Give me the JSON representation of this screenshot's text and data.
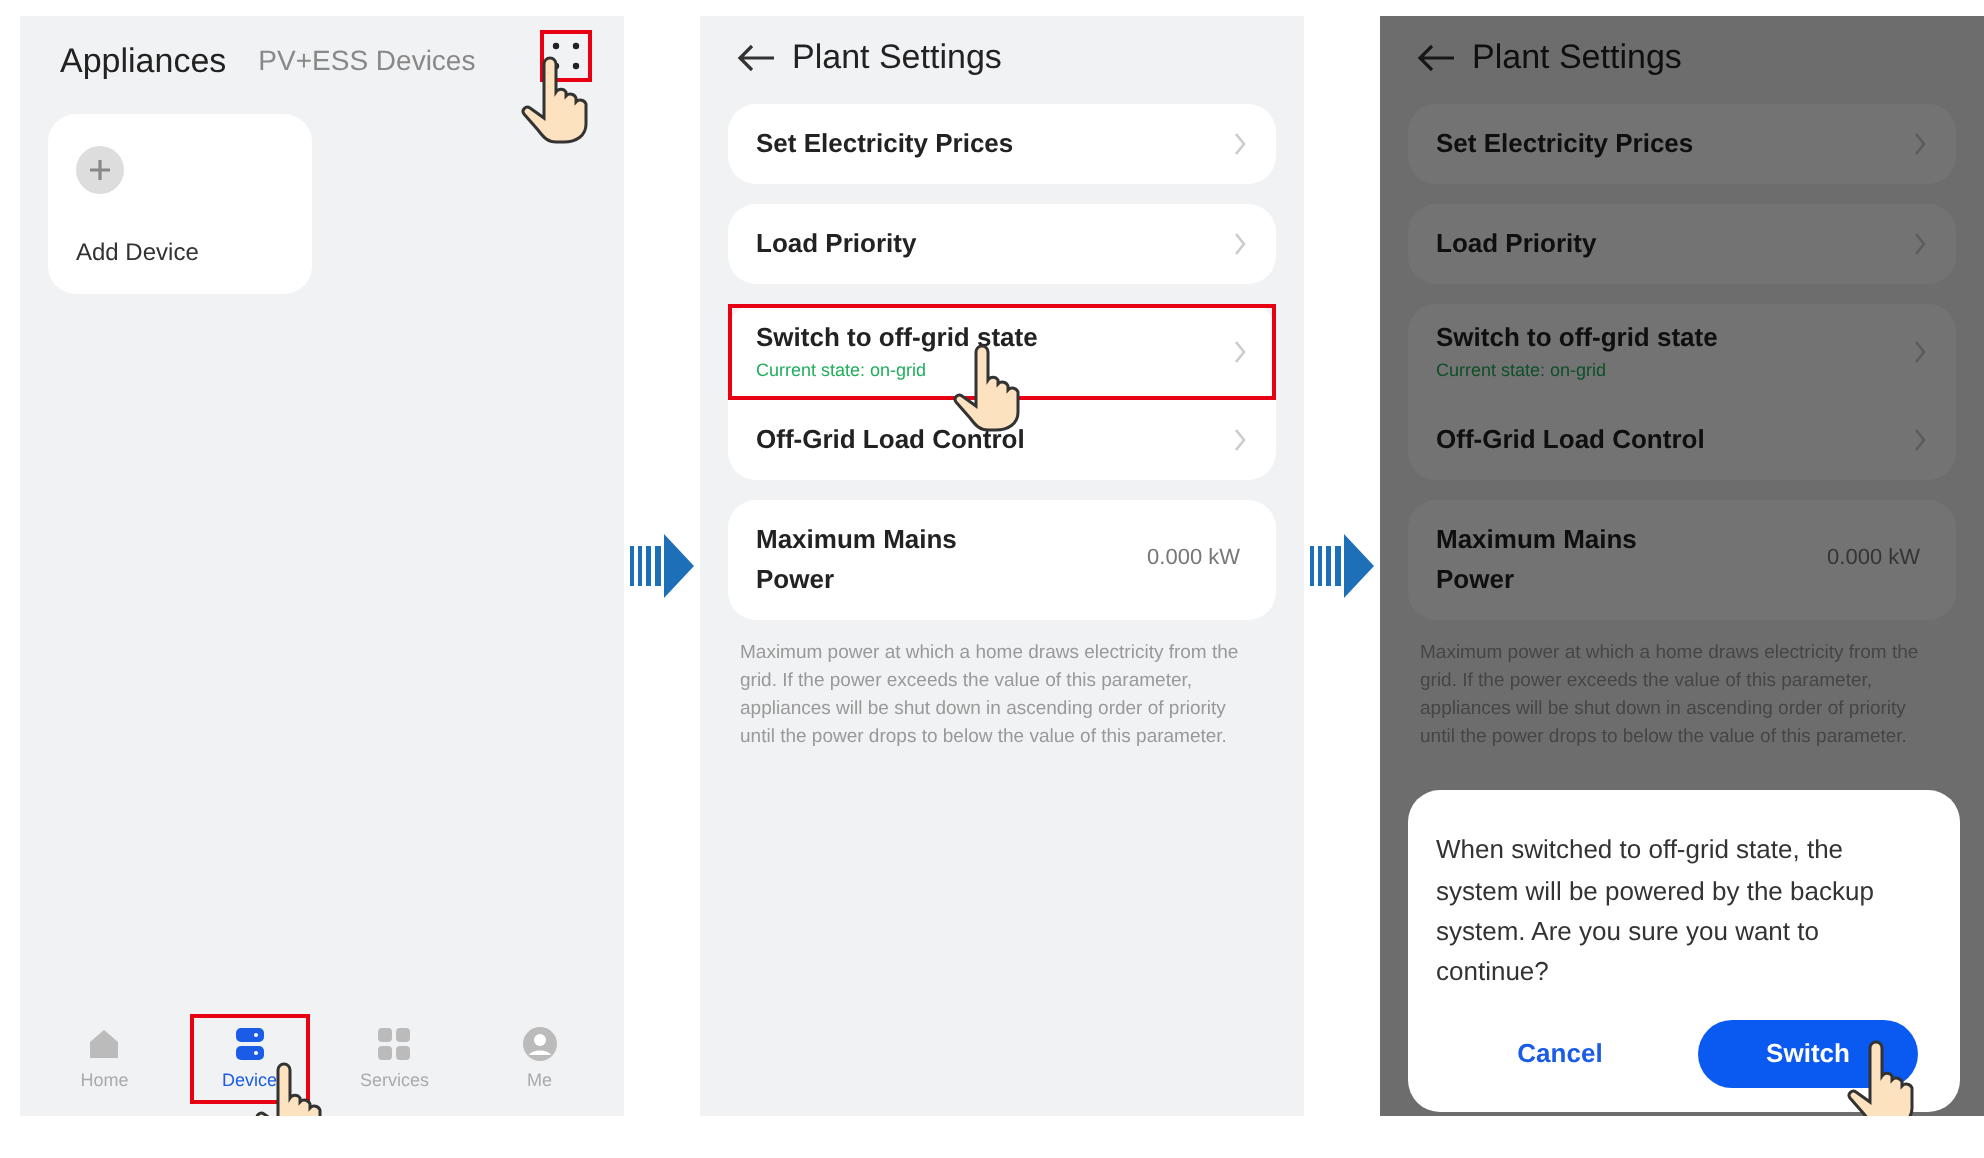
{
  "screens": [
    {
      "kind": "devices",
      "title": "Appliances",
      "subtitle": "PV+ESS Devices",
      "menu": {
        "highlighted": true,
        "tapped": true
      },
      "tiles": [
        {
          "label": "Add Device"
        }
      ],
      "tabs": [
        {
          "kind": "home",
          "label": "Home",
          "selected": false,
          "highlighted": false,
          "tapped": false
        },
        {
          "kind": "device",
          "label": "Device",
          "selected": true,
          "highlighted": true,
          "tapped": true
        },
        {
          "kind": "services",
          "label": "Services",
          "selected": false,
          "highlighted": false,
          "tapped": false
        },
        {
          "kind": "me",
          "label": "Me",
          "selected": false,
          "highlighted": false,
          "tapped": false
        }
      ]
    },
    {
      "kind": "settings",
      "title": "Plant Settings",
      "dimmed": false,
      "groups": [
        {
          "items": [
            {
              "label": "Set Electricity Prices",
              "highlighted": false,
              "tapped": false
            }
          ]
        },
        {
          "items": [
            {
              "label": "Load Priority",
              "highlighted": false,
              "tapped": false
            }
          ]
        },
        {
          "items": [
            {
              "label": "Switch to off-grid state",
              "status": "Current state: on-grid",
              "highlighted": true,
              "tapped": true
            },
            {
              "label": "Off-Grid Load Control",
              "highlighted": false,
              "tapped": false
            }
          ]
        },
        {
          "items": [
            {
              "label": "Maximum Mains Power",
              "value": "0.000 kW",
              "highlighted": false,
              "tapped": false
            }
          ]
        }
      ],
      "note": "Maximum power at which a home draws electricity from the grid. If the power exceeds the value of this parameter, appliances will be shut down in ascending order of priority until the power drops to below the value of this parameter."
    },
    {
      "kind": "settings",
      "title": "Plant Settings",
      "dimmed": true,
      "groups": [
        {
          "items": [
            {
              "label": "Set Electricity Prices",
              "highlighted": false,
              "tapped": false
            }
          ]
        },
        {
          "items": [
            {
              "label": "Load Priority",
              "highlighted": false,
              "tapped": false
            }
          ]
        },
        {
          "items": [
            {
              "label": "Switch to off-grid state",
              "status": "Current state: on-grid",
              "highlighted": false,
              "tapped": false
            },
            {
              "label": "Off-Grid Load Control",
              "highlighted": false,
              "tapped": false
            }
          ]
        },
        {
          "items": [
            {
              "label": "Maximum Mains Power",
              "value": "0.000 kW",
              "highlighted": false,
              "tapped": false
            }
          ]
        }
      ],
      "note": "Maximum power at which a home draws electricity from the grid. If the power exceeds the value of this parameter, appliances will be shut down in ascending order of priority until the power drops to below the value of this parameter.",
      "dialog": {
        "message": "When switched to off-grid state, the system will be powered by the backup system. Are you sure you want to continue?",
        "buttons": [
          {
            "kind": "text",
            "label": "Cancel",
            "tapped": false
          },
          {
            "kind": "primary",
            "label": "Switch",
            "tapped": true
          }
        ]
      }
    }
  ]
}
